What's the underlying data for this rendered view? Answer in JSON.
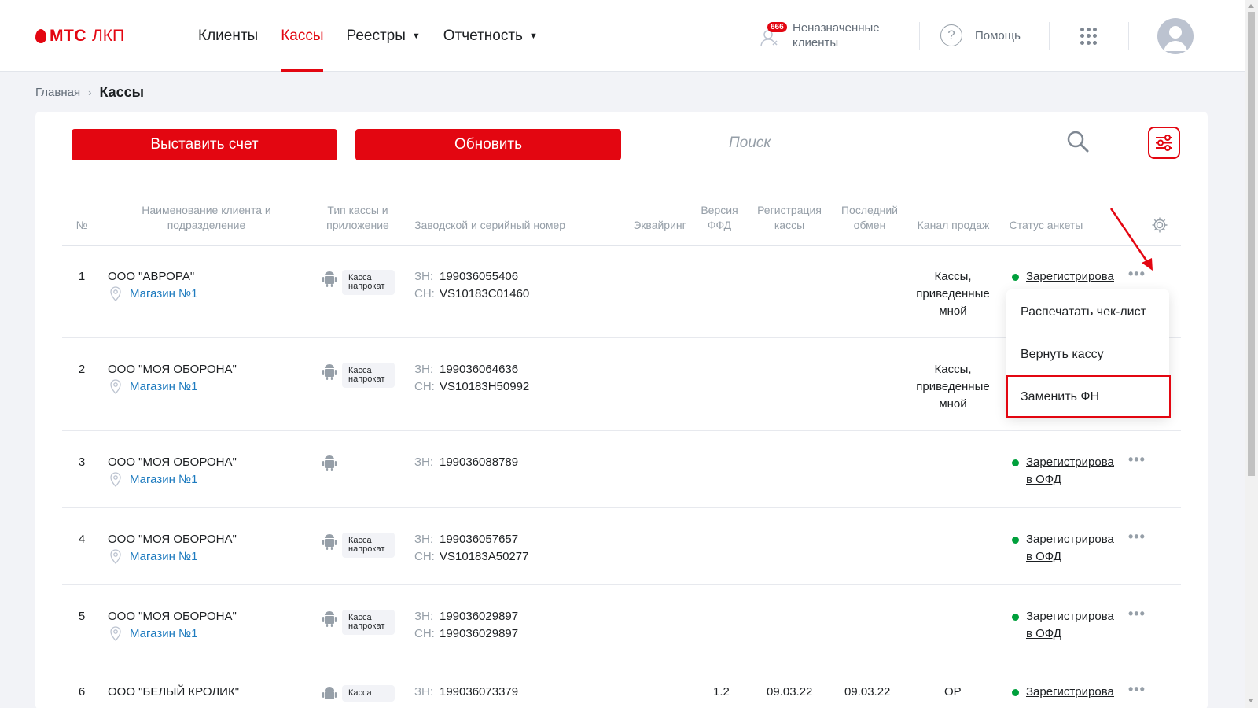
{
  "header": {
    "logo_brand": "МТС",
    "logo_product": "ЛКП",
    "nav": [
      {
        "label": "Клиенты"
      },
      {
        "label": "Кассы"
      },
      {
        "label": "Реестры"
      },
      {
        "label": "Отчетность"
      }
    ],
    "unassigned_badge": "666",
    "unassigned_label": "Неназначенные клиенты",
    "help_label": "Помощь",
    "help_icon": "?"
  },
  "breadcrumb": {
    "home": "Главная",
    "separator": "›",
    "current": "Кассы"
  },
  "toolbar": {
    "invoice_label": "Выставить счет",
    "refresh_label": "Обновить",
    "search_placeholder": "Поиск"
  },
  "table": {
    "headers": {
      "num": "№",
      "client": "Наименование клиента и подразделение",
      "type": "Тип кассы и приложение",
      "serial": "Заводской и серийный номер",
      "acquiring": "Эквайринг",
      "ffd": "Версия ФФД",
      "registration": "Регистрация кассы",
      "last_exchange": "Последний обмен",
      "channel": "Канал продаж",
      "status": "Статус анкеты"
    },
    "rows": [
      {
        "num": "1",
        "client": "ООО \"АВРОРА\"",
        "shop": "Магазин №1",
        "rent": "Касса напрокат",
        "zn_label": "ЗН:",
        "zn": "199036055406",
        "sn_label": "СН:",
        "sn": "VS10183C01460",
        "channel": "Кассы, приведенные мной",
        "status": "Зарегистрирована"
      },
      {
        "num": "2",
        "client": "ООО \"МОЯ ОБОРОНА\"",
        "shop": "Магазин №1",
        "rent": "Касса напрокат",
        "zn_label": "ЗН:",
        "zn": "199036064636",
        "sn_label": "СН:",
        "sn": "VS10183H50992",
        "channel": "Кассы, приведенные мной"
      },
      {
        "num": "3",
        "client": "ООО \"МОЯ ОБОРОНА\"",
        "shop": "Магазин №1",
        "zn_label": "ЗН:",
        "zn": "199036088789",
        "status": "Зарегистрирована в ОФД"
      },
      {
        "num": "4",
        "client": "ООО \"МОЯ ОБОРОНА\"",
        "shop": "Магазин №1",
        "rent": "Касса напрокат",
        "zn_label": "ЗН:",
        "zn": "199036057657",
        "sn_label": "СН:",
        "sn": "VS10183A50277",
        "status": "Зарегистрирована в ОФД"
      },
      {
        "num": "5",
        "client": "ООО \"МОЯ ОБОРОНА\"",
        "shop": "Магазин №1",
        "rent": "Касса напрокат",
        "zn_label": "ЗН:",
        "zn": "199036029897",
        "sn_label": "СН:",
        "sn": "199036029897",
        "status": "Зарегистрирована в ОФД"
      },
      {
        "num": "6",
        "client": "ООО \"БЕЛЫЙ КРОЛИК\"",
        "rent": "Касса",
        "zn_label": "ЗН:",
        "zn": "199036073379",
        "ffd": "1.2",
        "registration": "09.03.22",
        "last_exchange": "09.03.22",
        "channel": "ОР",
        "status": "Зарегистрирована"
      }
    ]
  },
  "context_menu": {
    "items": [
      {
        "label": "Распечатать чек-лист"
      },
      {
        "label": "Вернуть кассу"
      },
      {
        "label": "Заменить ФН"
      }
    ]
  },
  "colors": {
    "brand": "#e30611",
    "link": "#1e7bbf",
    "status_ok": "#00a03c"
  }
}
